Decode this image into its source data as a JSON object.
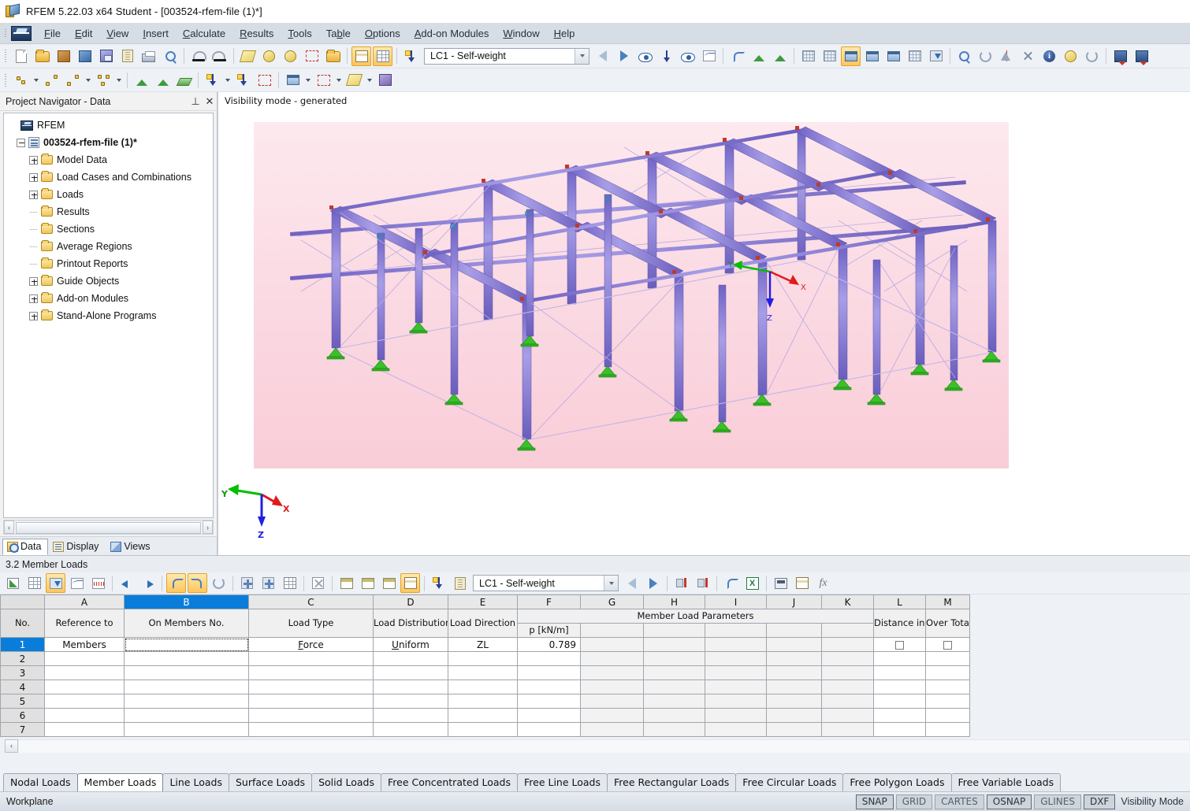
{
  "window": {
    "title": "RFEM 5.22.03 x64 Student - [003524-rfem-file (1)*]",
    "app_icon": "rfem-logo-icon"
  },
  "menu": {
    "items": [
      {
        "label": "File",
        "accel": "F"
      },
      {
        "label": "Edit",
        "accel": "E"
      },
      {
        "label": "View",
        "accel": "V"
      },
      {
        "label": "Insert",
        "accel": "I"
      },
      {
        "label": "Calculate",
        "accel": "C"
      },
      {
        "label": "Results",
        "accel": "R"
      },
      {
        "label": "Tools",
        "accel": "T"
      },
      {
        "label": "Table",
        "accel": "b"
      },
      {
        "label": "Options",
        "accel": "O"
      },
      {
        "label": "Add-on Modules",
        "accel": "A"
      },
      {
        "label": "Window",
        "accel": "W"
      },
      {
        "label": "Help",
        "accel": "H"
      }
    ]
  },
  "toolbar": {
    "load_case": "LC1 - Self-weight",
    "buttons_row1": [
      "new-icon",
      "open-icon",
      "open-model-icon",
      "save-as-model-icon",
      "save-icon",
      "clipboard-icon",
      "print-icon",
      "print-preview-icon",
      "undo-icon",
      "redo-icon",
      "plane-icon",
      "rotate-view-icon",
      "rotate-object-icon",
      "select-add-icon",
      "folder-new-icon",
      "table-panel-icon",
      "table-grid-icon"
    ],
    "buttons_row2": [
      "node-icon",
      "line-icon",
      "member-icon",
      "surface-polygon-icon",
      "nodal-support-icon",
      "line-support-icon",
      "surface-support-icon",
      "nodal-load-icon",
      "member-load-icon",
      "free-load-icon",
      "opening-icon",
      "solid-icon",
      "rib-icon",
      "cut-icon"
    ]
  },
  "navigator": {
    "header": "Project Navigator - Data",
    "pin_icon": "pin-icon",
    "close_icon": "close-icon",
    "tree": [
      {
        "label": "RFEM",
        "level": 0,
        "icon": "rfem-icon",
        "expander": "none",
        "bold": false
      },
      {
        "label": "003524-rfem-file (1)*",
        "level": 1,
        "icon": "file-icon",
        "expander": "minus",
        "bold": true
      },
      {
        "label": "Model Data",
        "level": 2,
        "icon": "folder-icon",
        "expander": "plus",
        "bold": false
      },
      {
        "label": "Load Cases and Combinations",
        "level": 2,
        "icon": "folder-icon",
        "expander": "plus",
        "bold": false
      },
      {
        "label": "Loads",
        "level": 2,
        "icon": "folder-icon",
        "expander": "plus",
        "bold": false
      },
      {
        "label": "Results",
        "level": 2,
        "icon": "folder-icon",
        "expander": "none",
        "bold": false
      },
      {
        "label": "Sections",
        "level": 2,
        "icon": "folder-icon",
        "expander": "none",
        "bold": false
      },
      {
        "label": "Average Regions",
        "level": 2,
        "icon": "folder-icon",
        "expander": "none",
        "bold": false
      },
      {
        "label": "Printout Reports",
        "level": 2,
        "icon": "folder-icon",
        "expander": "none",
        "bold": false
      },
      {
        "label": "Guide Objects",
        "level": 2,
        "icon": "folder-icon",
        "expander": "plus",
        "bold": false
      },
      {
        "label": "Add-on Modules",
        "level": 2,
        "icon": "folder-icon",
        "expander": "plus",
        "bold": false
      },
      {
        "label": "Stand-Alone Programs",
        "level": 2,
        "icon": "folder-icon",
        "expander": "plus",
        "bold": false
      }
    ],
    "tabs": [
      {
        "label": "Data",
        "icon": "data-icon",
        "active": true
      },
      {
        "label": "Display",
        "icon": "display-icon",
        "active": false
      },
      {
        "label": "Views",
        "icon": "views-icon",
        "active": false
      }
    ]
  },
  "viewport": {
    "visibility_label": "Visibility mode - generated",
    "axes": {
      "x": "X",
      "y": "Y",
      "z": "Z"
    },
    "colors": {
      "member": "#8a7fd4",
      "member_edge": "#5d52a8",
      "support": "#3fc030",
      "node": "#c0392b",
      "background_top": "#fde9ee",
      "background_bottom": "#f9cdd8",
      "axis_x": "#e01b1b",
      "axis_y": "#00c000",
      "axis_z": "#2020e0"
    }
  },
  "table_panel": {
    "title": "3.2 Member Loads",
    "load_case": "LC1 - Self-weight",
    "toolbar_icons": [
      "table-edit-icon",
      "table-insert-icon",
      "table-import-icon",
      "table-curve-icon",
      "table-wave-icon",
      "prev-table-icon",
      "next-table-icon",
      "undo-icon",
      "redo-icon",
      "refresh-icon",
      "add-row-icon",
      "settings-row-icon",
      "options-row-icon",
      "delete-row-icon",
      "col-header-icon",
      "col-format-icon",
      "col-edit-icon",
      "print-table-icon",
      "new-load-icon",
      "load-settings-icon",
      "prev-lc-icon",
      "next-lc-icon",
      "sort-asc-icon",
      "sort-desc-icon",
      "filter-icon",
      "excel-icon",
      "calculator-icon",
      "rename-icon",
      "formula-icon"
    ],
    "columns": [
      {
        "letter": "A",
        "title": "Reference to",
        "selected": false
      },
      {
        "letter": "B",
        "title": "On Members No.",
        "selected": true
      },
      {
        "letter": "C",
        "title": "Load Type",
        "selected": false
      },
      {
        "letter": "D",
        "title": "Load Distribution",
        "selected": false
      },
      {
        "letter": "E",
        "title": "Load Direction",
        "selected": false
      },
      {
        "letter": "F",
        "title": "p [kN/m]",
        "selected": false
      },
      {
        "letter": "G",
        "title": "",
        "selected": false
      },
      {
        "letter": "H",
        "title": "",
        "selected": false
      },
      {
        "letter": "I",
        "title": "",
        "selected": false
      },
      {
        "letter": "J",
        "title": "",
        "selected": false
      },
      {
        "letter": "K",
        "title": "",
        "selected": false
      },
      {
        "letter": "L",
        "title": "Distance in %",
        "selected": false
      },
      {
        "letter": "M",
        "title": "Over Total Length",
        "selected": false
      }
    ],
    "group_header": "Member Load Parameters",
    "row_header_label": "No.",
    "rows": [
      {
        "no": "1",
        "selected": true,
        "cells": [
          "Members",
          "",
          "Force",
          "Uniform",
          "ZL",
          "0.789",
          "",
          "",
          "",
          "",
          "",
          "checkbox",
          "checkbox"
        ]
      },
      {
        "no": "2",
        "selected": false,
        "cells": [
          "",
          "",
          "",
          "",
          "",
          "",
          "",
          "",
          "",
          "",
          "",
          "",
          ""
        ]
      },
      {
        "no": "3",
        "selected": false,
        "cells": [
          "",
          "",
          "",
          "",
          "",
          "",
          "",
          "",
          "",
          "",
          "",
          "",
          ""
        ]
      },
      {
        "no": "4",
        "selected": false,
        "cells": [
          "",
          "",
          "",
          "",
          "",
          "",
          "",
          "",
          "",
          "",
          "",
          "",
          ""
        ]
      },
      {
        "no": "5",
        "selected": false,
        "cells": [
          "",
          "",
          "",
          "",
          "",
          "",
          "",
          "",
          "",
          "",
          "",
          "",
          ""
        ]
      },
      {
        "no": "6",
        "selected": false,
        "cells": [
          "",
          "",
          "",
          "",
          "",
          "",
          "",
          "",
          "",
          "",
          "",
          "",
          ""
        ]
      },
      {
        "no": "7",
        "selected": false,
        "cells": [
          "",
          "",
          "",
          "",
          "",
          "",
          "",
          "",
          "",
          "",
          "",
          "",
          ""
        ]
      }
    ],
    "tabs": [
      {
        "label": "Nodal Loads",
        "active": false
      },
      {
        "label": "Member Loads",
        "active": true
      },
      {
        "label": "Line Loads",
        "active": false
      },
      {
        "label": "Surface Loads",
        "active": false
      },
      {
        "label": "Solid Loads",
        "active": false
      },
      {
        "label": "Free Concentrated Loads",
        "active": false
      },
      {
        "label": "Free Line Loads",
        "active": false
      },
      {
        "label": "Free Rectangular Loads",
        "active": false
      },
      {
        "label": "Free Circular Loads",
        "active": false
      },
      {
        "label": "Free Polygon Loads",
        "active": false
      },
      {
        "label": "Free Variable Loads",
        "active": false
      }
    ]
  },
  "statusbar": {
    "left_text": "Workplane",
    "indicators": [
      {
        "label": "SNAP",
        "on": true
      },
      {
        "label": "GRID",
        "on": false
      },
      {
        "label": "CARTES",
        "on": false
      },
      {
        "label": "OSNAP",
        "on": true
      },
      {
        "label": "GLINES",
        "on": false
      },
      {
        "label": "DXF",
        "on": true
      }
    ],
    "mode_text": "Visibility Mode"
  }
}
